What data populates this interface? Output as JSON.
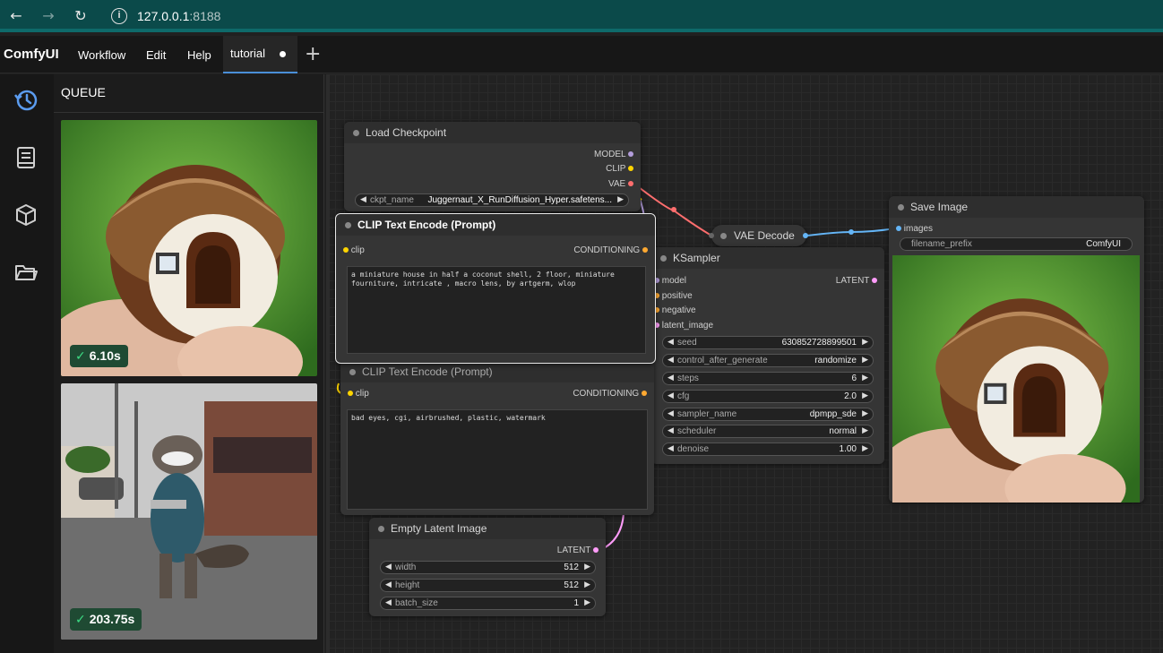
{
  "browser": {
    "back_icon": "arrow-left-icon",
    "forward_icon": "arrow-right-icon",
    "reload_icon": "reload-icon",
    "url_host": "127.0.0.1",
    "url_port": ":8188"
  },
  "menu": {
    "logo": "ComfyUI",
    "items": [
      "Workflow",
      "Edit",
      "Help"
    ],
    "tab": "tutorial",
    "add_tab": "+"
  },
  "sidebar": {
    "icons": [
      "history-icon",
      "book-icon",
      "cube-icon",
      "folder-icon"
    ]
  },
  "queue": {
    "title": "QUEUE",
    "items": [
      {
        "time": "6.10s"
      },
      {
        "time": "203.75s"
      }
    ]
  },
  "nodes": {
    "load_checkpoint": {
      "title": "Load Checkpoint",
      "outputs": [
        "MODEL",
        "CLIP",
        "VAE"
      ],
      "ckpt_label": "ckpt_name",
      "ckpt_value": "Juggernaut_X_RunDiffusion_Hyper.safetens..."
    },
    "clip_pos": {
      "title": "CLIP Text Encode (Prompt)",
      "input": "clip",
      "output": "CONDITIONING",
      "text": "a miniature house in half a coconut shell, 2 floor, miniature fourniture, intricate , macro lens, by artgerm, wlop"
    },
    "clip_neg": {
      "title": "CLIP Text Encode (Prompt)",
      "input": "clip",
      "output": "CONDITIONING",
      "text": "bad eyes, cgi, airbrushed, plastic, watermark"
    },
    "vae_decode": {
      "title": "VAE Decode"
    },
    "ksampler": {
      "title": "KSampler",
      "inputs": [
        "model",
        "positive",
        "negative",
        "latent_image"
      ],
      "output": "LATENT",
      "widgets": [
        {
          "label": "seed",
          "value": "630852728899501"
        },
        {
          "label": "control_after_generate",
          "value": "randomize"
        },
        {
          "label": "steps",
          "value": "6"
        },
        {
          "label": "cfg",
          "value": "2.0"
        },
        {
          "label": "sampler_name",
          "value": "dpmpp_sde"
        },
        {
          "label": "scheduler",
          "value": "normal"
        },
        {
          "label": "denoise",
          "value": "1.00"
        }
      ]
    },
    "save_image": {
      "title": "Save Image",
      "input": "images",
      "prefix_label": "filename_prefix",
      "prefix_value": "ComfyUI"
    },
    "empty_latent": {
      "title": "Empty Latent Image",
      "output": "LATENT",
      "widgets": [
        {
          "label": "width",
          "value": "512"
        },
        {
          "label": "height",
          "value": "512"
        },
        {
          "label": "batch_size",
          "value": "1"
        }
      ]
    }
  },
  "colors": {
    "model": "#b39ddb",
    "clip": "#ffd500",
    "vae": "#ff6e6e",
    "conditioning": "#ffa931",
    "latent": "#ff9cf9",
    "image": "#64b5f6"
  }
}
